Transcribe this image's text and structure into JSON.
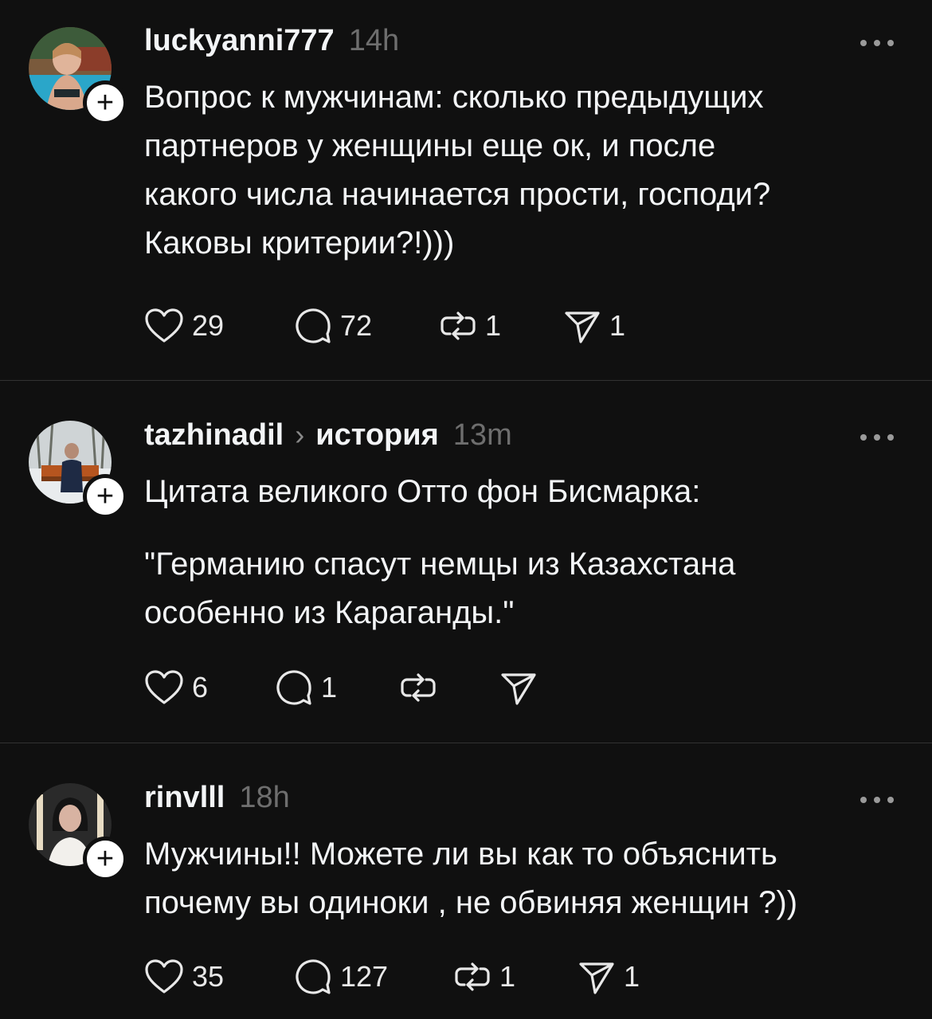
{
  "posts": [
    {
      "username": "luckyanni777",
      "topic": "",
      "time": "14h",
      "lines": [
        "Вопрос к мужчинам: сколько предыдущих",
        "партнеров у женщины еще ок, и после",
        "какого числа начинается прости, господи?",
        "Каковы критерии?!)))"
      ],
      "likes": "29",
      "comments": "72",
      "reposts": "1",
      "shares": "1"
    },
    {
      "username": "tazhinadil",
      "topic": "история",
      "time": "13m",
      "lines": [
        "Цитата великого Отто фон Бисмарка:",
        "",
        "\"Германию спасут немцы из Казахстана",
        "особенно из Караганды.\""
      ],
      "likes": "6",
      "comments": "1",
      "reposts": "",
      "shares": ""
    },
    {
      "username": "rinvlll",
      "topic": "",
      "time": "18h",
      "lines": [
        "Мужчины!! Можете ли вы как то объяснить",
        "почему вы одиноки , не обвиняя женщин ?))"
      ],
      "likes": "35",
      "comments": "127",
      "reposts": "1",
      "shares": "1"
    }
  ],
  "icons": {
    "like": "heart-icon",
    "comment": "comment-bubble-icon",
    "repost": "repost-icon",
    "share": "send-icon",
    "more": "more-dots-icon",
    "follow": "plus-icon"
  },
  "colors": {
    "background": "#101010",
    "text": "#f3f5f7",
    "muted": "#6e6e6e",
    "divider": "#323232"
  }
}
